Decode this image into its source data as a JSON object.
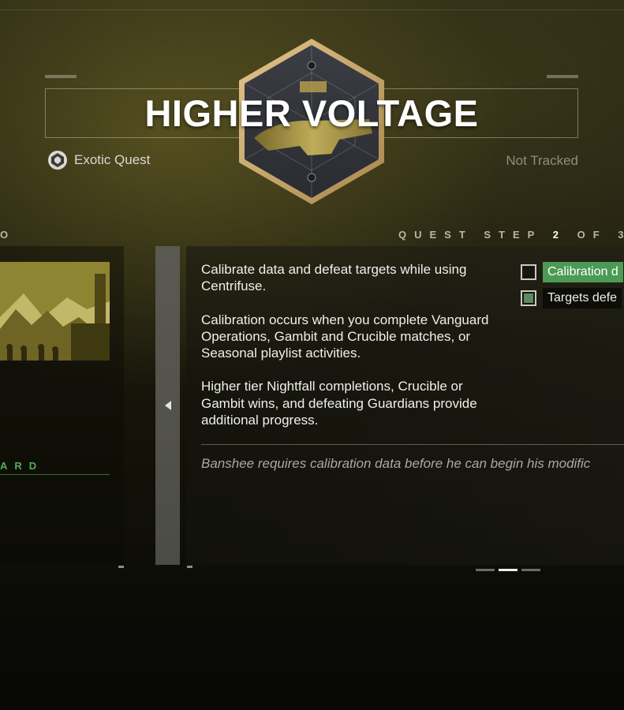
{
  "quest": {
    "title": "HIGHER VOLTAGE",
    "type_label": "Exotic Quest",
    "type_icon": "exotic-quest-icon",
    "tracking_status": "Not Tracked",
    "emblem_icon": "centrifuse-weapon-emblem"
  },
  "progress": {
    "left_label_fragment": "O",
    "step_word": "QUEST STEP",
    "step_current": "2",
    "step_of": "OF",
    "step_total_fragment": "3",
    "current_step": 2
  },
  "left_panel": {
    "reward_label_fragment": "ARD"
  },
  "description": {
    "paragraphs": [
      "Calibrate data and defeat targets while using Centrifuse.",
      "Calibration occurs when you complete Vanguard Operations, Gambit and Crucible matches, or Seasonal playlist activities.",
      "Higher tier Nightfall completions, Crucible or Gambit wins, and defeating Guardians provide additional progress."
    ],
    "lore": "Banshee requires calibration data before he can begin his modific"
  },
  "objectives": [
    {
      "label": "Calibration d",
      "complete": false
    },
    {
      "label": "Targets defe",
      "complete": true
    }
  ],
  "pagination": {
    "pages": 3,
    "active": 2
  },
  "colors": {
    "accent_green": "#4fae5a",
    "objective_highlight": "#5d8a5f",
    "emblem_border": "#c9a76a"
  }
}
